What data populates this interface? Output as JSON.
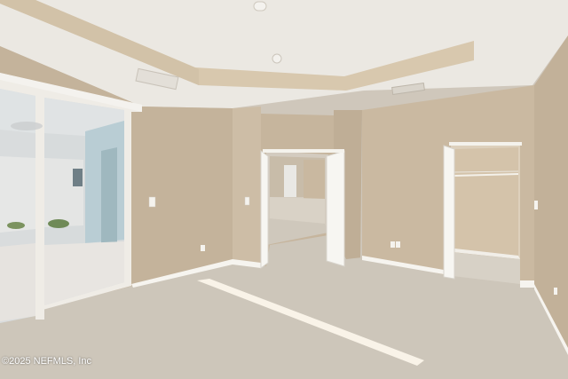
{
  "photo": {
    "subject": "empty-bedroom-interior",
    "colors": {
      "wall": "#c9b9a3",
      "ceiling": "#ece9e3",
      "carpet": "#cfc8bc",
      "trim": "#ffffff",
      "tray_band": "#d6c7ae",
      "sunlight": "#fbf6ea"
    }
  },
  "watermark": {
    "text": "©2025 NEFMLS, Inc"
  }
}
